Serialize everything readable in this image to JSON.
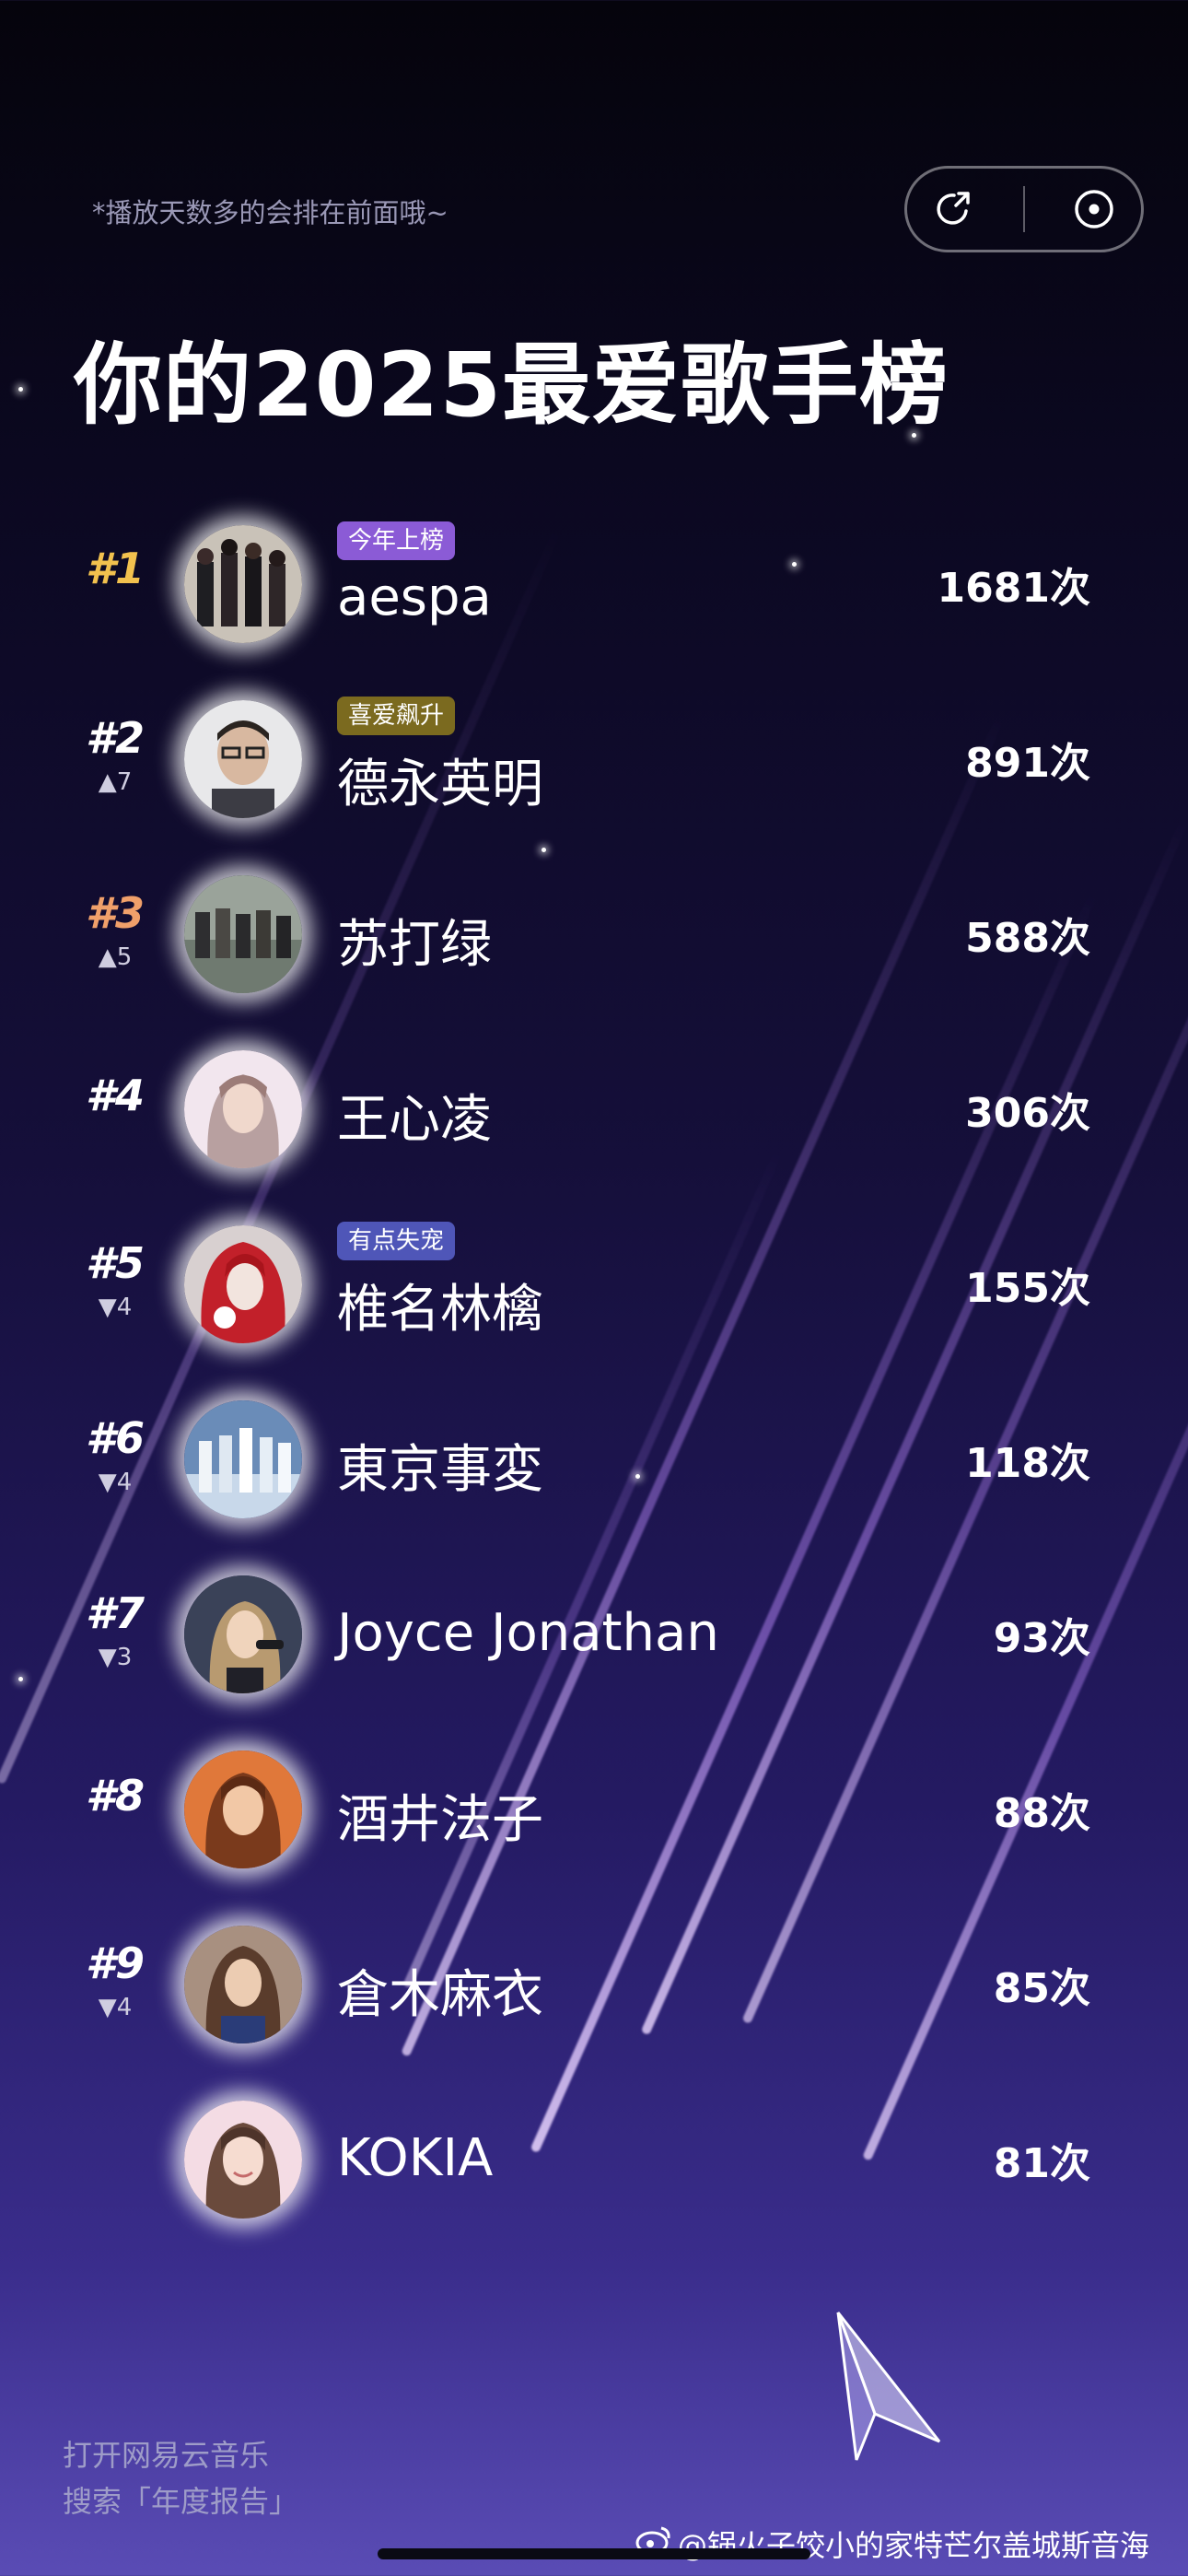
{
  "header": {
    "hint": "*播放天数多的会排在前面哦~",
    "share_icon": "share-icon",
    "record_icon": "record-icon"
  },
  "title": "你的2025最爱歌手榜",
  "artists": [
    {
      "rank": "#1",
      "change": "",
      "name": "aespa",
      "tag": "今年上榜",
      "count": "1681次",
      "rank_color": "#f2c14e",
      "tag_color": "#8b5bd6"
    },
    {
      "rank": "#2",
      "change": "▲7",
      "name": "德永英明",
      "tag": "喜爱飙升",
      "count": "891次",
      "rank_color": "#ffffff",
      "tag_color": "#7b6a1f"
    },
    {
      "rank": "#3",
      "change": "▲5",
      "name": "苏打绿",
      "tag": "",
      "count": "588次",
      "rank_color": "#f0a06a",
      "tag_color": ""
    },
    {
      "rank": "#4",
      "change": "",
      "name": "王心凌",
      "tag": "",
      "count": "306次",
      "rank_color": "#ffffff",
      "tag_color": ""
    },
    {
      "rank": "#5",
      "change": "▼4",
      "name": "椎名林檎",
      "tag": "有点失宠",
      "count": "155次",
      "rank_color": "#ffffff",
      "tag_color": "#4f56b8"
    },
    {
      "rank": "#6",
      "change": "▼4",
      "name": "東京事変",
      "tag": "",
      "count": "118次",
      "rank_color": "#ffffff",
      "tag_color": ""
    },
    {
      "rank": "#7",
      "change": "▼3",
      "name": "Joyce Jonathan",
      "tag": "",
      "count": "93次",
      "rank_color": "#ffffff",
      "tag_color": ""
    },
    {
      "rank": "#8",
      "change": "",
      "name": "酒井法子",
      "tag": "",
      "count": "88次",
      "rank_color": "#ffffff",
      "tag_color": ""
    },
    {
      "rank": "#9",
      "change": "▼4",
      "name": "倉木麻衣",
      "tag": "",
      "count": "85次",
      "rank_color": "#ffffff",
      "tag_color": ""
    },
    {
      "rank": "",
      "change": "",
      "name": "KOKIA",
      "tag": "",
      "count": "81次",
      "rank_color": "#ffffff",
      "tag_color": ""
    }
  ],
  "footer": {
    "line1": "打开网易云音乐",
    "line2": "搜索「年度报告」",
    "watermark": "@锅火子饺小的家特芒尔盖城斯音海"
  }
}
